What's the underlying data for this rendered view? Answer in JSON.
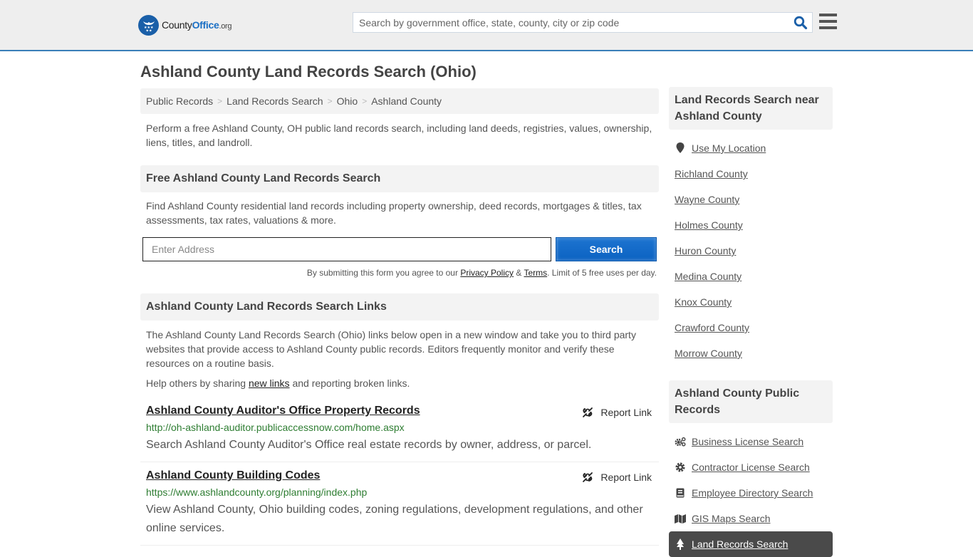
{
  "header": {
    "logo": {
      "name_part1": "County",
      "name_part2": "Office",
      "name_part3": ".org",
      "icon": "eagle-stars-badge-icon",
      "brand_color": "#1a5fa8"
    },
    "search": {
      "placeholder": "Search by government office, state, county, city or zip code",
      "value": "",
      "icon": "search-icon"
    },
    "menu_icon": "hamburger-menu-icon",
    "accent_border_color": "#3a7fb8"
  },
  "page": {
    "title": "Ashland County Land Records Search (Ohio)"
  },
  "breadcrumb": [
    {
      "label": "Public Records"
    },
    {
      "label": "Land Records Search"
    },
    {
      "label": "Ohio"
    },
    {
      "label": "Ashland County"
    }
  ],
  "intro": "Perform a free Ashland County, OH public land records search, including land deeds, registries, values, ownership, liens, titles, and landroll.",
  "free_search": {
    "heading": "Free Ashland County Land Records Search",
    "description": "Find Ashland County residential land records including property ownership, deed records, mortgages & titles, tax assessments, tax rates, valuations & more.",
    "address_placeholder": "Enter Address",
    "address_value": "",
    "submit_label": "Search",
    "submit_color": "#1169c9",
    "disclaimer_prefix": "By submitting this form you agree to our ",
    "privacy_label": "Privacy Policy",
    "amp": " & ",
    "terms_label": "Terms",
    "disclaimer_suffix": ". Limit of 5 free uses per day."
  },
  "links_section": {
    "heading": "Ashland County Land Records Search Links",
    "description": "The Ashland County Land Records Search (Ohio) links below open in a new window and take you to third party websites that provide access to Ashland County public records. Editors frequently monitor and verify these resources on a routine basis.",
    "help_prefix": "Help others by sharing ",
    "help_link": "new links",
    "help_suffix": " and reporting broken links.",
    "report_label": "Report Link",
    "report_icon": "broken-link-icon",
    "items": [
      {
        "title": "Ashland County Auditor's Office Property Records",
        "url": "http://oh-ashland-auditor.publicaccessnow.com/home.aspx",
        "description": "Search Ashland County Auditor's Office real estate records by owner, address, or parcel."
      },
      {
        "title": "Ashland County Building Codes",
        "url": "https://www.ashlandcounty.org/planning/index.php",
        "description": "View Ashland County, Ohio building codes, zoning regulations, development regulations, and other online services."
      }
    ]
  },
  "sidebar": {
    "nearby": {
      "heading": "Land Records Search near Ashland County",
      "use_location": {
        "label": "Use My Location",
        "icon": "map-pin-icon"
      },
      "counties": [
        "Richland County",
        "Wayne County",
        "Holmes County",
        "Huron County",
        "Medina County",
        "Knox County",
        "Crawford County",
        "Morrow County"
      ]
    },
    "public_records": {
      "heading": "Ashland County Public Records",
      "items": [
        {
          "label": "Business License Search",
          "icon": "gears-icon"
        },
        {
          "label": "Contractor License Search",
          "icon": "gear-icon"
        },
        {
          "label": "Employee Directory Search",
          "icon": "book-icon"
        },
        {
          "label": "GIS Maps Search",
          "icon": "map-icon"
        }
      ],
      "active_item": {
        "label": "Land Records Search",
        "icon": "tree-icon"
      }
    }
  }
}
